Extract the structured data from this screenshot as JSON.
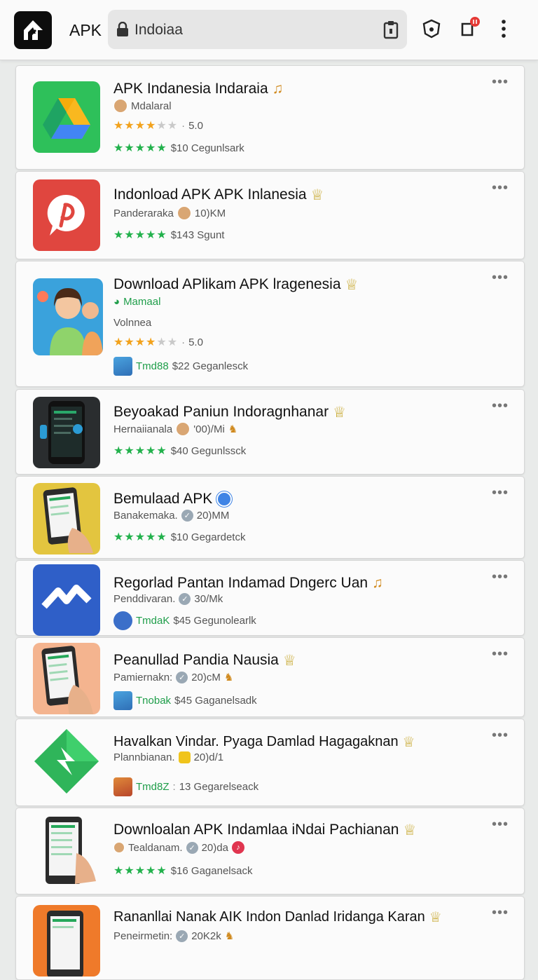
{
  "topbar": {
    "brand": "APK",
    "search_value": "Indoiaa"
  },
  "colors": {
    "accent_green": "#22b14c",
    "star_orange": "#f2a21c",
    "notification_red": "#e53935"
  },
  "items": [
    {
      "title": "APK Indanesia Indaraia",
      "sub": "Mdalaral",
      "rating": "5.0",
      "stats": "$10 Cegunlsark"
    },
    {
      "title": "Indonload APK APK Inlanesia",
      "sub": "Panderaraka",
      "size": "10)KM",
      "stats": "$143 Sgunt"
    },
    {
      "title": "Download APlikam APK lragenesia",
      "sub": "Mamaal",
      "sub2": "Volnnea",
      "rating": "5.0",
      "tag": "Tmd88",
      "stats": "$22 Geganlesck"
    },
    {
      "title": "Beyoakad Paniun Indoragnhanar",
      "sub": "Hernaiianala",
      "size": "'00)/Mi",
      "stats": "$40 Gegunlssck"
    },
    {
      "title": "Bemulaad APK",
      "sub": "Banakemaka.",
      "size": "20)MM",
      "stats": "$10 Gegardetck"
    },
    {
      "title": "Regorlad Pantan Indamad Dngerc Uan",
      "sub": "Penddivaran.",
      "size": "30/Mk",
      "tag": "TmdaK",
      "stats": "$45 Gegunolearlk"
    },
    {
      "title": "Peanullad Pandia Nausia",
      "sub": "Pamiernakn:",
      "size": "20)cM",
      "tag": "Tnobak",
      "stats": "$45 Gaganelsadk"
    },
    {
      "title": "Havalkan Vindar. Pyaga Damlad Hagagaknan",
      "sub": "Plannbianan.",
      "size": "20)d/1",
      "tag": "Tmd8Z",
      "stats": "13 Gegarelseack"
    },
    {
      "title": "Downloalan APK Indamlaa iNdai Pachianan",
      "sub": "Tealdanam.",
      "size": "20)da",
      "stats": "$16 Gaganelsack"
    },
    {
      "title": "Rananllai Nanak AIK Indon Danlad Iridanga Karan",
      "sub": "Peneirmetin:",
      "size": "20K2k"
    }
  ]
}
